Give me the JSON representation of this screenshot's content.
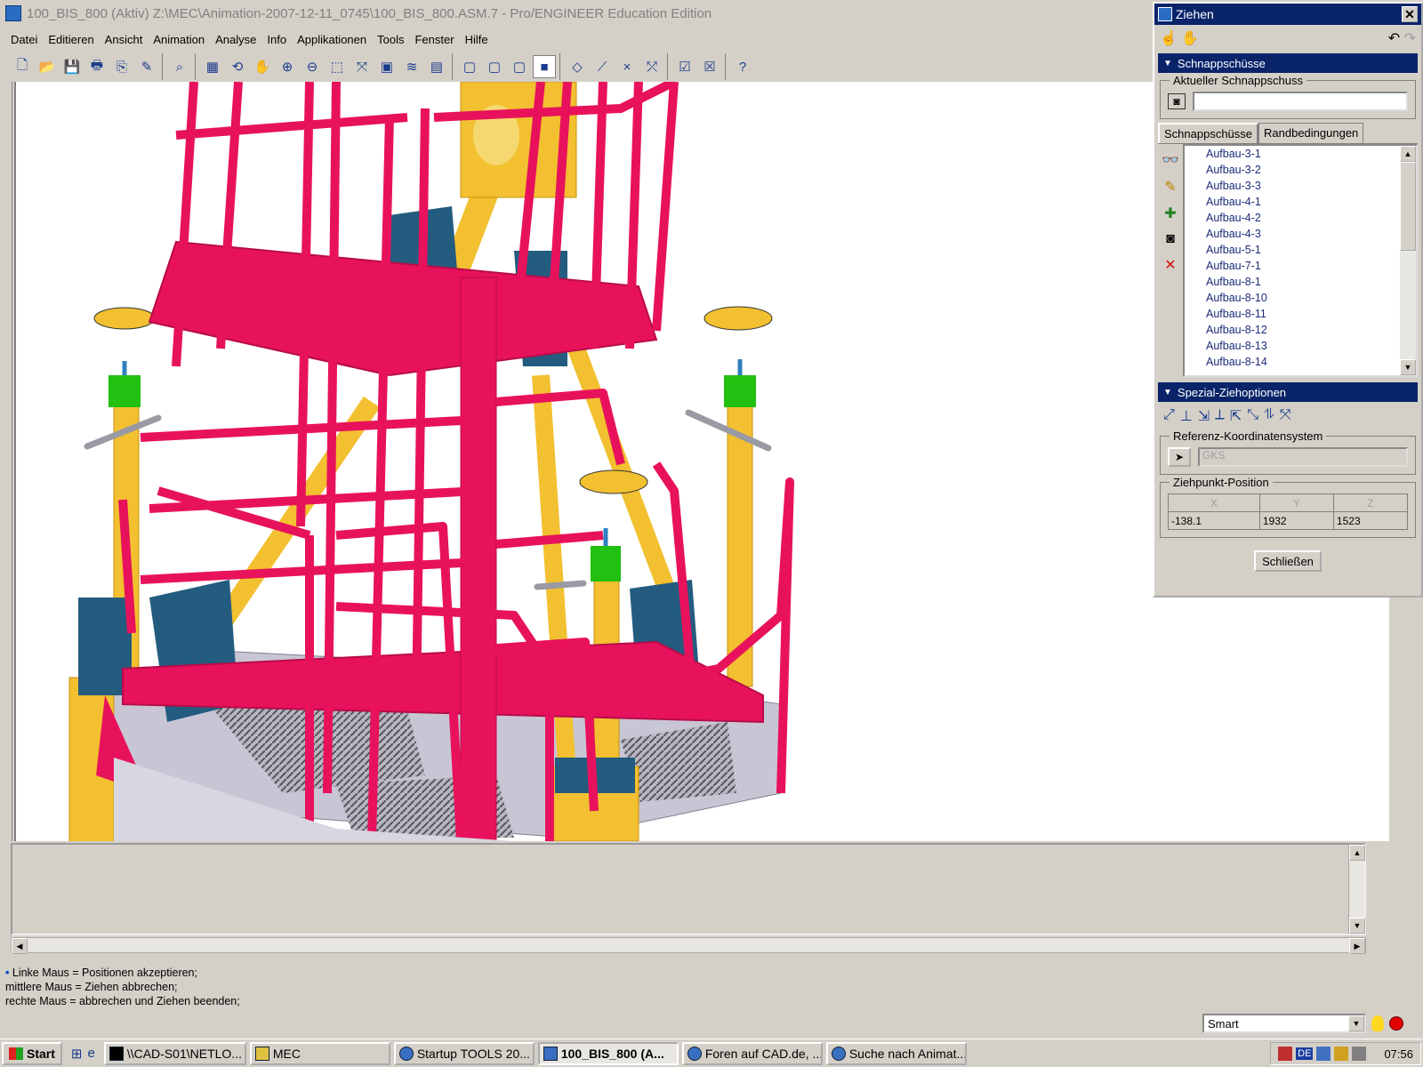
{
  "window": {
    "title": "100_BIS_800 (Aktiv) Z:\\MEC\\Animation-2007-12-11_0745\\100_BIS_800.ASM.7 - Pro/ENGINEER Education Edition"
  },
  "menu": [
    "Datei",
    "Editieren",
    "Ansicht",
    "Animation",
    "Analyse",
    "Info",
    "Applikationen",
    "Tools",
    "Fenster",
    "Hilfe"
  ],
  "toolbar_glyphs": {
    "new": "🗋",
    "open": "📂",
    "save": "💾",
    "print": "🖶",
    "copy": "⎘",
    "edit": "✎",
    "find": "⌕",
    "repaint": "▦",
    "spin": "⟲",
    "pan": "✋",
    "zoom_in": "⊕",
    "zoom_out": "⊖",
    "refit": "⬚",
    "orient": "⤧",
    "views": "▣",
    "layers": "≋",
    "model_tree": "▤",
    "wire": "▢",
    "hidden": "▢",
    "no_hidden": "▢",
    "shading": "■",
    "datum_plane": "◇",
    "datum_axis": "⟋",
    "datum_point": "×",
    "csys": "⤱",
    "window_activate": "☑",
    "window_close": "☒",
    "context_help": "?"
  },
  "dialog": {
    "title": "Ziehen",
    "close_glyph": "✕",
    "tool_glyphs": {
      "drag_point": "☝",
      "drag_body": "✋",
      "undo": "↶",
      "redo": "↷"
    },
    "snapshots_header": "Schnappschüsse",
    "current_snapshot_label": "Aktueller Schnappschuss",
    "current_snapshot_value": "",
    "camera_glyph": "◙",
    "tabs": [
      "Schnappschüsse",
      "Randbedingungen"
    ],
    "list_side_glyphs": {
      "view": "👓",
      "edit": "✎",
      "add": "✚",
      "capture": "◙",
      "delete": "✕"
    },
    "snapshot_list": [
      "Aufbau-3-1",
      "Aufbau-3-2",
      "Aufbau-3-3",
      "Aufbau-4-1",
      "Aufbau-4-2",
      "Aufbau-4-3",
      "Aufbau-5-1",
      "Aufbau-7-1",
      "Aufbau-8-1",
      "Aufbau-8-10",
      "Aufbau-8-11",
      "Aufbau-8-12",
      "Aufbau-8-13",
      "Aufbau-8-14"
    ],
    "special_options_header": "Spezial-Ziehoptionen",
    "special_icons": [
      "⤢",
      "⊥",
      "⇲",
      "⟂",
      "⇱",
      "⤡",
      "⥮",
      "⤧"
    ],
    "ref_csys_label": "Referenz-Koordinatensystem",
    "ref_csys_value": "GKS",
    "select_glyph": "➤",
    "drag_position_label": "Ziehpunkt-Position",
    "position": {
      "x_label": "X",
      "y_label": "Y",
      "z_label": "Z",
      "x": "-138.1",
      "y": "1932",
      "z": "1523"
    },
    "close_button": "Schließen"
  },
  "scroll_glyphs": {
    "up": "▲",
    "down": "▼",
    "left": "◀",
    "right": "▶"
  },
  "hint": {
    "line1": "Linke Maus = Positionen akzeptieren;",
    "line2": "mittlere Maus = Ziehen abbrechen;",
    "line3": "rechte Maus = abbrechen und Ziehen beenden;"
  },
  "selection_filter": "Smart",
  "taskbar": {
    "start": "Start",
    "quicklaunch": [
      "⊞",
      "e"
    ],
    "tasks": [
      {
        "label": "\\\\CAD-S01\\NETLO...",
        "active": false
      },
      {
        "label": "MEC",
        "active": false
      },
      {
        "label": "Startup TOOLS 20...",
        "active": false
      },
      {
        "label": "100_BIS_800 (A...",
        "active": true
      },
      {
        "label": "Foren auf CAD.de, ...",
        "active": false
      },
      {
        "label": "Suche nach Animat...",
        "active": false
      }
    ],
    "lang": "DE",
    "clock": "07:56"
  },
  "colors": {
    "frame_magenta": "#e8125c",
    "frame_magenta_dark": "#b80c48",
    "support_yellow": "#f2c030",
    "support_yellow_dark": "#c89010",
    "joint_blue": "#245c80",
    "cap_green": "#22c010",
    "grating_gray": "#9a98a8",
    "title_blue": "#0a246a"
  }
}
